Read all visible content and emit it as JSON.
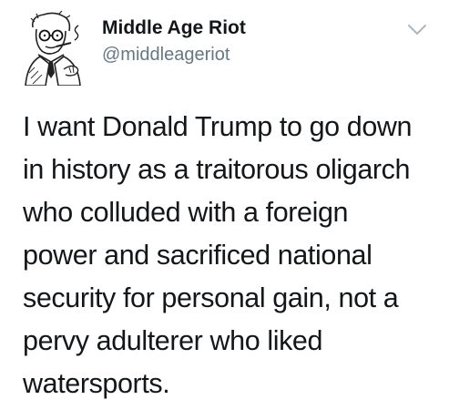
{
  "tweet": {
    "author": {
      "display_name": "Middle Age Riot",
      "handle": "@middleageriot"
    },
    "text": "I want Donald Trump to go down\nin history as a traitorous oligarch\nwho colluded with a foreign\npower and sacrificed national\nsecurity for personal gain, not a\npervy adulterer who liked\nwatersports."
  },
  "icons": {
    "avatar": "avatar-illustration",
    "menu": "chevron-down-icon"
  },
  "colors": {
    "text": "#14171a",
    "secondary": "#657786",
    "chevron": "#aab8c2"
  }
}
